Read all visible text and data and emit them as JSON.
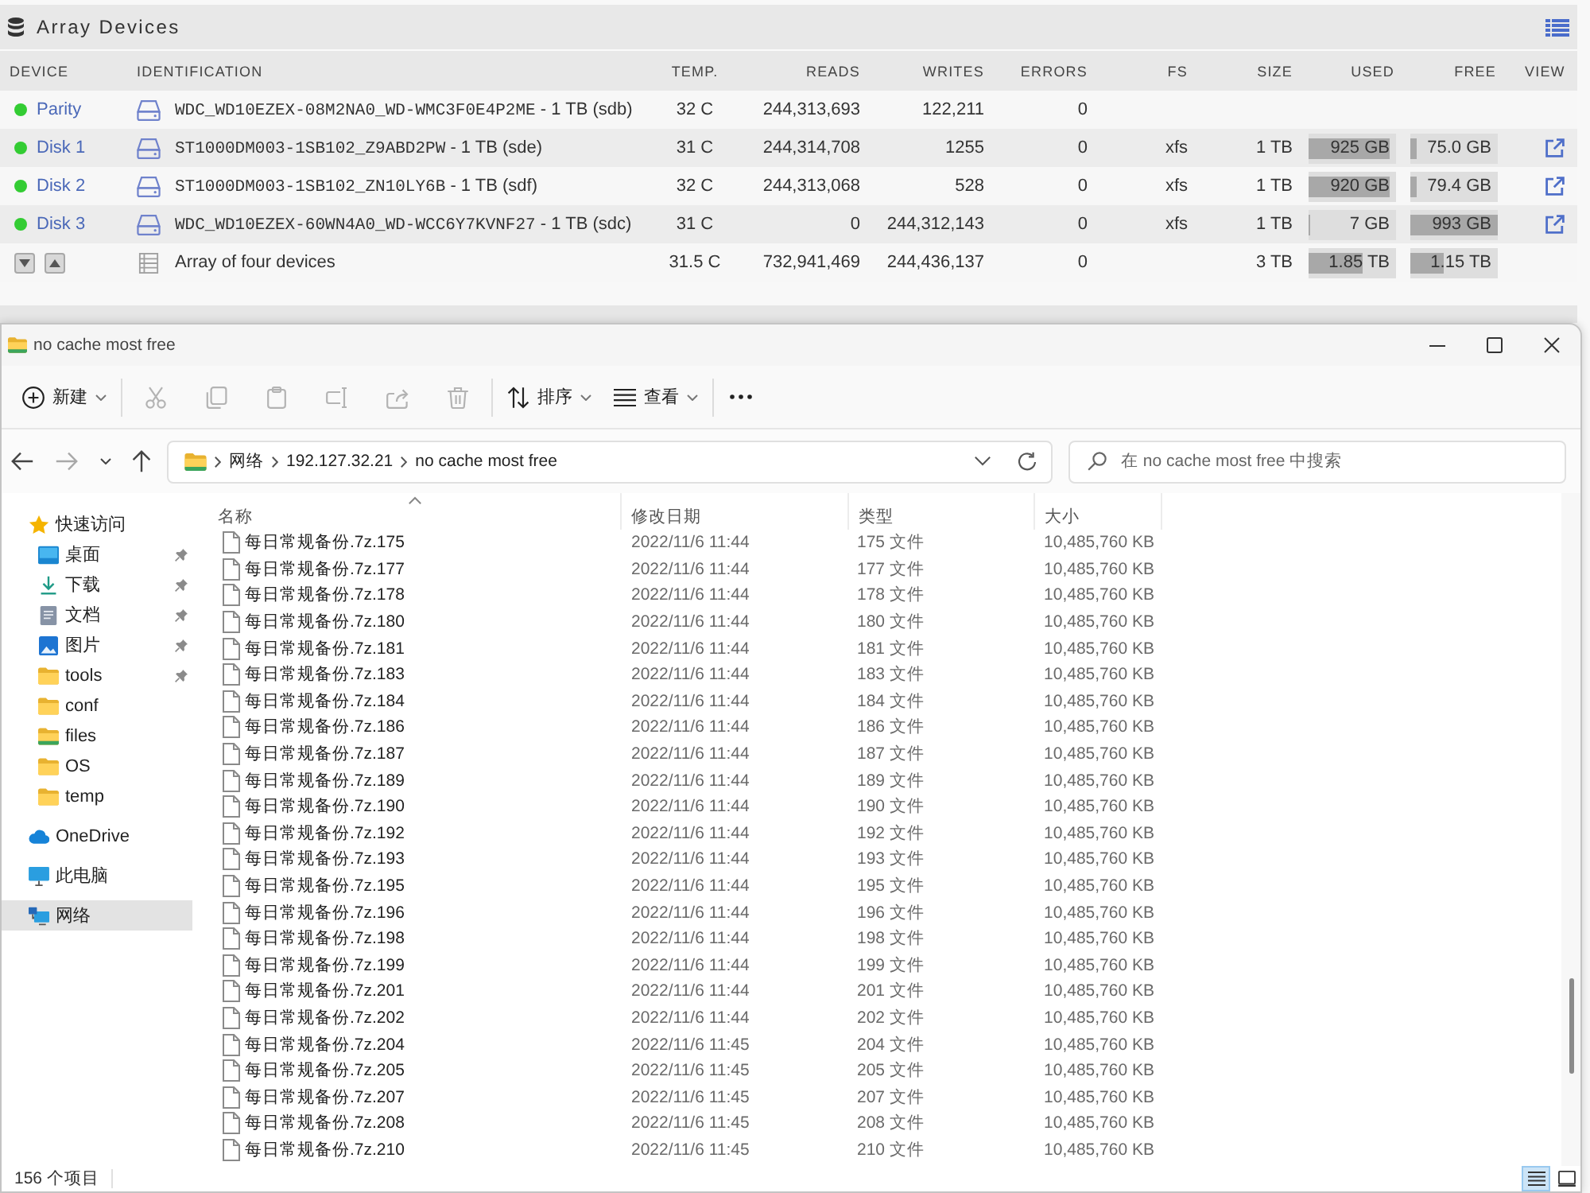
{
  "array_panel": {
    "title": "Array Devices",
    "columns": [
      "DEVICE",
      "IDENTIFICATION",
      "TEMP.",
      "READS",
      "WRITES",
      "ERRORS",
      "FS",
      "SIZE",
      "USED",
      "FREE",
      "VIEW"
    ],
    "rows": [
      {
        "kind": "device",
        "name": "Parity",
        "color": "#33cc33",
        "model": "WDC_WD10EZEX-08M2NA0_WD-WMC3F0E4P2ME",
        "detail": "- 1 TB (sdb)",
        "temp": "32 C",
        "reads": "244,313,693",
        "writes": "122,211",
        "errors": "0",
        "view": false
      },
      {
        "kind": "device",
        "name": "Disk 1",
        "color": "#33cc33",
        "model": "ST1000DM003-1SB102_Z9ABD2PW",
        "detail": "- 1 TB (sde)",
        "temp": "31 C",
        "reads": "244,314,708",
        "writes": "1255",
        "errors": "0",
        "fs": "xfs",
        "size": "1 TB",
        "used": {
          "text": "925 GB",
          "level": 0.925
        },
        "free": {
          "text": "75.0 GB",
          "level": 0.075
        },
        "view": true
      },
      {
        "kind": "device",
        "name": "Disk 2",
        "color": "#33cc33",
        "model": "ST1000DM003-1SB102_ZN10LY6B",
        "detail": "- 1 TB (sdf)",
        "temp": "32 C",
        "reads": "244,313,068",
        "writes": "528",
        "errors": "0",
        "fs": "xfs",
        "size": "1 TB",
        "used": {
          "text": "920 GB",
          "level": 0.92
        },
        "free": {
          "text": "79.4 GB",
          "level": 0.079
        },
        "view": true
      },
      {
        "kind": "device",
        "name": "Disk 3",
        "color": "#33cc33",
        "model": "WDC_WD10EZEX-60WN4A0_WD-WCC6Y7KVNF27",
        "detail": "- 1 TB (sdc)",
        "temp": "31 C",
        "reads": "0",
        "writes": "244,312,143",
        "errors": "0",
        "fs": "xfs",
        "size": "1 TB",
        "used": {
          "text": "7 GB",
          "level": 0.007
        },
        "free": {
          "text": "993 GB",
          "level": 0.993
        },
        "view": true
      },
      {
        "kind": "total",
        "label": "Array of four devices",
        "temp": "31.5 C",
        "reads": "732,941,469",
        "writes": "244,436,137",
        "errors": "0",
        "size": "3 TB",
        "used": {
          "text": "1.85 TB",
          "level": 0.617
        },
        "free": {
          "text": "1.15 TB",
          "level": 0.383
        },
        "view": false
      }
    ]
  },
  "explorer": {
    "title": "no cache most free",
    "toolbar": [
      {
        "kind": "new",
        "label": "新建",
        "disabled": false
      },
      {
        "kind": "cut",
        "disabled": true
      },
      {
        "kind": "copy",
        "disabled": true
      },
      {
        "kind": "paste",
        "disabled": true
      },
      {
        "kind": "rename",
        "disabled": true
      },
      {
        "kind": "share",
        "disabled": true
      },
      {
        "kind": "delete",
        "disabled": true
      },
      {
        "kind": "sort",
        "label": "排序",
        "disabled": false
      },
      {
        "kind": "view",
        "label": "查看",
        "disabled": false
      },
      {
        "kind": "more",
        "disabled": false
      }
    ],
    "nav": [
      {
        "kind": "back",
        "disabled": false
      },
      {
        "kind": "forward",
        "disabled": true
      },
      {
        "kind": "recent",
        "disabled": false
      },
      {
        "kind": "up",
        "disabled": false
      }
    ],
    "breadcrumbs": [
      "网络",
      "192.127.32.21",
      "no cache most free"
    ],
    "search": {
      "placeholder": "在 no cache most free 中搜索"
    },
    "sidebar": [
      {
        "kind": "quick_access",
        "label": "快速访问",
        "selected": false,
        "children": [
          {
            "kind": "desktop",
            "label": "桌面",
            "pinned": true,
            "selected": false
          },
          {
            "kind": "downloads",
            "label": "下载",
            "pinned": true,
            "selected": false
          },
          {
            "kind": "documents",
            "label": "文档",
            "pinned": true,
            "selected": false
          },
          {
            "kind": "pictures",
            "label": "图片",
            "pinned": true,
            "selected": false
          },
          {
            "kind": "folder",
            "label": "tools",
            "pinned": true,
            "selected": false
          },
          {
            "kind": "folder",
            "label": "conf",
            "pinned": false,
            "selected": false
          },
          {
            "kind": "synced_folder",
            "label": "files",
            "pinned": false,
            "selected": false
          },
          {
            "kind": "folder",
            "label": "OS",
            "pinned": false,
            "selected": false
          },
          {
            "kind": "folder",
            "label": "temp",
            "pinned": false,
            "selected": false
          }
        ]
      },
      {
        "kind": "onedrive",
        "label": "OneDrive",
        "selected": false
      },
      {
        "kind": "this_pc",
        "label": "此电脑",
        "selected": false
      },
      {
        "kind": "network",
        "label": "网络",
        "selected": true
      }
    ],
    "columns": [
      {
        "label": "名称",
        "sorted": true
      },
      {
        "label": "修改日期",
        "sorted": false
      },
      {
        "label": "类型",
        "sorted": false
      },
      {
        "label": "大小",
        "sorted": false
      }
    ],
    "files": [
      {
        "name": "每日常规备份.7z.175",
        "modified": "2022/11/6 11:44",
        "type": "175 文件",
        "size": "10,485,760 KB"
      },
      {
        "name": "每日常规备份.7z.177",
        "modified": "2022/11/6 11:44",
        "type": "177 文件",
        "size": "10,485,760 KB"
      },
      {
        "name": "每日常规备份.7z.178",
        "modified": "2022/11/6 11:44",
        "type": "178 文件",
        "size": "10,485,760 KB"
      },
      {
        "name": "每日常规备份.7z.180",
        "modified": "2022/11/6 11:44",
        "type": "180 文件",
        "size": "10,485,760 KB"
      },
      {
        "name": "每日常规备份.7z.181",
        "modified": "2022/11/6 11:44",
        "type": "181 文件",
        "size": "10,485,760 KB"
      },
      {
        "name": "每日常规备份.7z.183",
        "modified": "2022/11/6 11:44",
        "type": "183 文件",
        "size": "10,485,760 KB"
      },
      {
        "name": "每日常规备份.7z.184",
        "modified": "2022/11/6 11:44",
        "type": "184 文件",
        "size": "10,485,760 KB"
      },
      {
        "name": "每日常规备份.7z.186",
        "modified": "2022/11/6 11:44",
        "type": "186 文件",
        "size": "10,485,760 KB"
      },
      {
        "name": "每日常规备份.7z.187",
        "modified": "2022/11/6 11:44",
        "type": "187 文件",
        "size": "10,485,760 KB"
      },
      {
        "name": "每日常规备份.7z.189",
        "modified": "2022/11/6 11:44",
        "type": "189 文件",
        "size": "10,485,760 KB"
      },
      {
        "name": "每日常规备份.7z.190",
        "modified": "2022/11/6 11:44",
        "type": "190 文件",
        "size": "10,485,760 KB"
      },
      {
        "name": "每日常规备份.7z.192",
        "modified": "2022/11/6 11:44",
        "type": "192 文件",
        "size": "10,485,760 KB"
      },
      {
        "name": "每日常规备份.7z.193",
        "modified": "2022/11/6 11:44",
        "type": "193 文件",
        "size": "10,485,760 KB"
      },
      {
        "name": "每日常规备份.7z.195",
        "modified": "2022/11/6 11:44",
        "type": "195 文件",
        "size": "10,485,760 KB"
      },
      {
        "name": "每日常规备份.7z.196",
        "modified": "2022/11/6 11:44",
        "type": "196 文件",
        "size": "10,485,760 KB"
      },
      {
        "name": "每日常规备份.7z.198",
        "modified": "2022/11/6 11:44",
        "type": "198 文件",
        "size": "10,485,760 KB"
      },
      {
        "name": "每日常规备份.7z.199",
        "modified": "2022/11/6 11:44",
        "type": "199 文件",
        "size": "10,485,760 KB"
      },
      {
        "name": "每日常规备份.7z.201",
        "modified": "2022/11/6 11:44",
        "type": "201 文件",
        "size": "10,485,760 KB"
      },
      {
        "name": "每日常规备份.7z.202",
        "modified": "2022/11/6 11:44",
        "type": "202 文件",
        "size": "10,485,760 KB"
      },
      {
        "name": "每日常规备份.7z.204",
        "modified": "2022/11/6 11:45",
        "type": "204 文件",
        "size": "10,485,760 KB"
      },
      {
        "name": "每日常规备份.7z.205",
        "modified": "2022/11/6 11:45",
        "type": "205 文件",
        "size": "10,485,760 KB"
      },
      {
        "name": "每日常规备份.7z.207",
        "modified": "2022/11/6 11:45",
        "type": "207 文件",
        "size": "10,485,760 KB"
      },
      {
        "name": "每日常规备份.7z.208",
        "modified": "2022/11/6 11:45",
        "type": "208 文件",
        "size": "10,485,760 KB"
      },
      {
        "name": "每日常规备份.7z.210",
        "modified": "2022/11/6 11:45",
        "type": "210 文件",
        "size": "10,485,760 KB"
      }
    ],
    "status": {
      "item_count": "156 个项目",
      "views": [
        {
          "kind": "details",
          "selected": true
        },
        {
          "kind": "tiles",
          "selected": false
        }
      ]
    }
  }
}
